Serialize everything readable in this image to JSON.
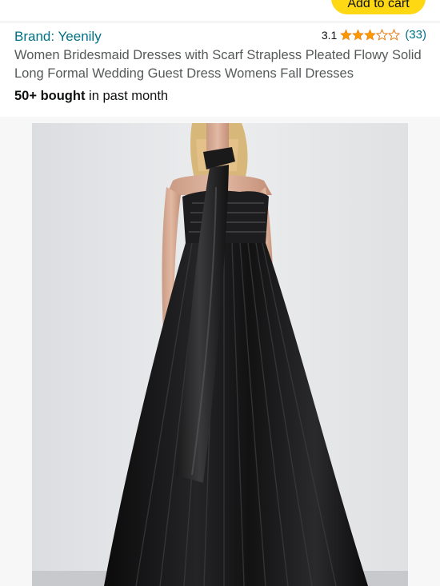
{
  "header": {
    "add_to_cart_label": "Add to cart"
  },
  "product": {
    "brand": "Brand: Yeenily",
    "rating_value": "3.1",
    "rating_stars": 3.1,
    "rating_count": "(33)",
    "title": "Women Bridesmaid Dresses with Scarf Strapless Pleated Flowy Solid Long Formal Wedding Guest Dress Womens Fall Dresses",
    "bought_bold": "50+ bought",
    "bought_rest": " in past month"
  },
  "gallery": {
    "image_alt": "Black strapless pleated long dress with scarf"
  },
  "colors": {
    "link": "#007185",
    "star": "#ff9900",
    "button": "#ffd814"
  }
}
